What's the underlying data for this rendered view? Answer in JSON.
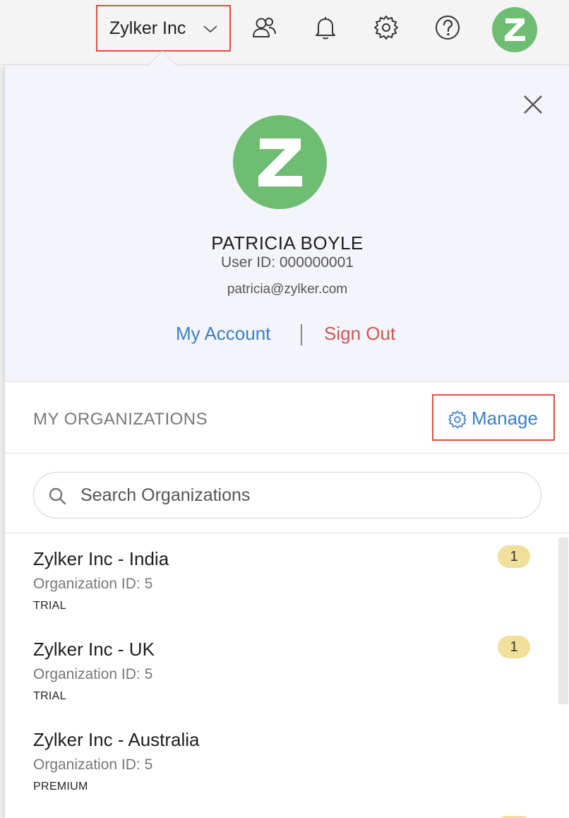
{
  "topbar": {
    "org_name": "Zylker Inc",
    "avatar_letter": "Z",
    "icons": [
      "users-icon",
      "bell-icon",
      "gear-icon",
      "help-icon"
    ]
  },
  "profile": {
    "avatar_letter": "Z",
    "name": "PATRICIA BOYLE",
    "user_id": "User ID: 000000001",
    "email": "patricia@zylker.com",
    "my_account_label": "My Account",
    "sign_out_label": "Sign Out"
  },
  "organizations": {
    "title": "MY ORGANIZATIONS",
    "manage_label": "Manage",
    "search_placeholder": "Search Organizations",
    "items": [
      {
        "name": "Zylker Inc - India",
        "org_id": "Organization ID: 5",
        "plan": "TRIAL",
        "badge": "1"
      },
      {
        "name": "Zylker Inc - UK",
        "org_id": "Organization ID: 5",
        "plan": "TRIAL",
        "badge": "1"
      },
      {
        "name": "Zylker Inc - Australia",
        "org_id": "Organization ID: 5",
        "plan": "PREMIUM",
        "badge": ""
      }
    ]
  },
  "colors": {
    "accent_blue": "#3b7fc4",
    "sign_out_red": "#d8534f",
    "highlight_border": "#e0503a",
    "avatar_green": "#6fbc73",
    "badge_yellow": "#f1df9a"
  }
}
